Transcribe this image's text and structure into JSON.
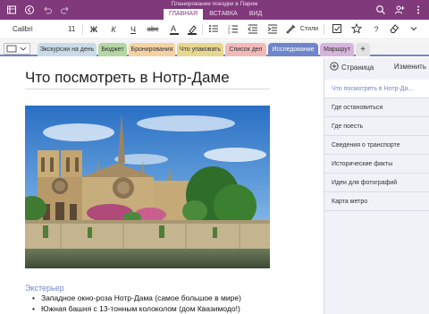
{
  "titlebar": {
    "doc_title": "Планирование поездки в Париж",
    "tabs": [
      {
        "label": "ГЛАВНАЯ",
        "active": true
      },
      {
        "label": "ВСТАВКА",
        "active": false
      },
      {
        "label": "ВИД",
        "active": false
      }
    ],
    "left_icons": [
      "notebooks-icon",
      "back-icon",
      "undo-icon",
      "redo-icon"
    ],
    "right_icons": [
      "search-icon",
      "share-person-icon",
      "more-icon"
    ]
  },
  "toolbar": {
    "font_name": "Calibri",
    "font_size": "11",
    "bold": "Ж",
    "italic": "К",
    "underline": "Ч",
    "strikethrough": "abc",
    "styles_label": "Стили",
    "help": "?"
  },
  "sections": {
    "tabs": [
      {
        "label": "Экскурсии на день",
        "color": "#c9dbe8",
        "active": false
      },
      {
        "label": "Бюджет",
        "color": "#b4d7a3",
        "active": false
      },
      {
        "label": "Бронирования",
        "color": "#f4d2a4",
        "active": false
      },
      {
        "label": "Что упаковать",
        "color": "#e8d790",
        "active": false
      },
      {
        "label": "Список дел",
        "color": "#f2b9b9",
        "active": false
      },
      {
        "label": "Исследование",
        "color": "#6f85c9",
        "active": true
      },
      {
        "label": "Маршрут",
        "color": "#d7b4dd",
        "active": false
      },
      {
        "label": "+",
        "color": "#e2e2e2",
        "active": false
      }
    ]
  },
  "page": {
    "title": "Что посмотреть в Нотр-Даме",
    "heading": "Экстерьер",
    "bullets": [
      "Западное окно-роза Нотр-Дама (самое большое в мире)",
      "Южная башня с 13-тонным колоколом (дом Квазимодо!)"
    ]
  },
  "pane": {
    "add_page": "Страница",
    "edit": "Изменить",
    "pages": [
      {
        "label": "Что посмотреть в Нотр-Да...",
        "active": true
      },
      {
        "label": "Где остановиться",
        "active": false
      },
      {
        "label": "Где поесть",
        "active": false
      },
      {
        "label": "Сведения о транспорте",
        "active": false
      },
      {
        "label": "Исторические факты",
        "active": false
      },
      {
        "label": "Идеи для фотографий",
        "active": false
      },
      {
        "label": "Карта метро",
        "active": false
      }
    ]
  },
  "colors": {
    "titlebar": "#80397b",
    "accent_blue": "#6f85c9",
    "pane_bg": "#f0f2f8"
  }
}
